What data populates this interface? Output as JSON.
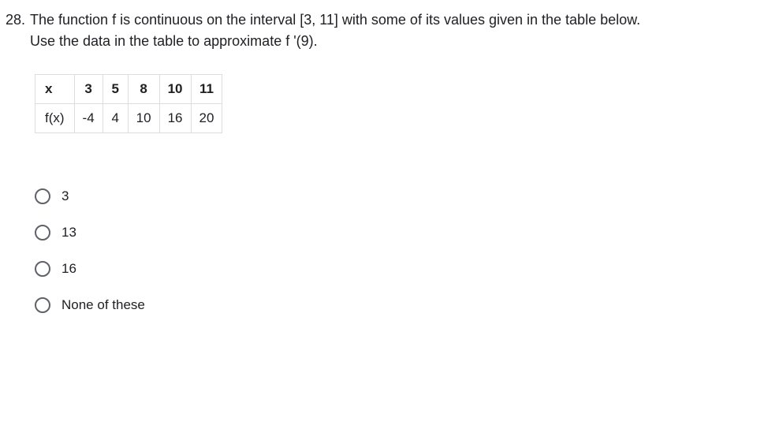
{
  "question": {
    "number": "28.",
    "text_line1": "The function f is continuous on the interval [3, 11] with some of its values given in the table below.",
    "text_line2": "Use the data in the table to approximate f '(9)."
  },
  "chart_data": {
    "type": "table",
    "title": "",
    "rows": [
      {
        "label": "x",
        "values": [
          "3",
          "5",
          "8",
          "10",
          "11"
        ]
      },
      {
        "label": "f(x)",
        "values": [
          "-4",
          "4",
          "10",
          "16",
          "20"
        ]
      }
    ]
  },
  "options": [
    {
      "label": "3"
    },
    {
      "label": "13"
    },
    {
      "label": "16"
    },
    {
      "label": "None of these"
    }
  ]
}
